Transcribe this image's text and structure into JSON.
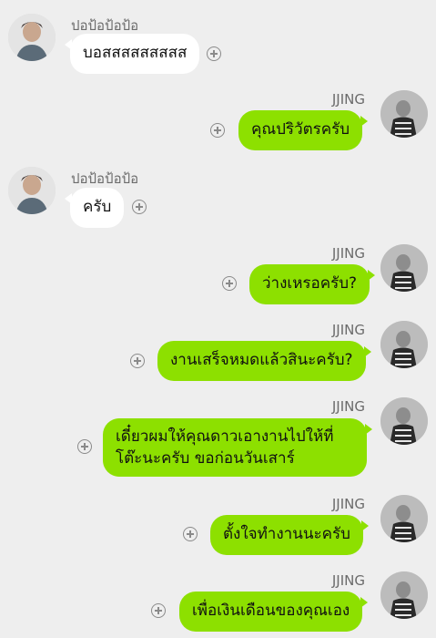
{
  "messages": [
    {
      "sender": "ปอป้อป้อป้อ",
      "side": "in",
      "text": "บอสสสสสสสสส"
    },
    {
      "sender": "JJING",
      "side": "out",
      "text": "คุณปริวัตรครับ"
    },
    {
      "sender": "ปอป้อป้อป้อ",
      "side": "in",
      "text": "ครับ"
    },
    {
      "sender": "JJING",
      "side": "out",
      "text": "ว่างเหรอครับ?"
    },
    {
      "sender": "JJING",
      "side": "out",
      "text": "งานเสร็จหมดแล้วสินะครับ?"
    },
    {
      "sender": "JJING",
      "side": "out",
      "lines": [
        "เดี๋ยวผมให้คุณดาวเอางานไปให้ที่",
        "โต๊ะนะครับ ขอก่อนวันเสาร์"
      ]
    },
    {
      "sender": "JJING",
      "side": "out",
      "text": "ตั้งใจทำงานนะครับ"
    },
    {
      "sender": "JJING",
      "side": "out",
      "text": "เพื่อเงินเดือนของคุณเอง"
    }
  ],
  "icons": {
    "add": "plus-circle-icon",
    "avatar_in": "avatar",
    "avatar_out": "avatar"
  },
  "colors": {
    "background": "#eeeeee",
    "outgoing_bubble": "#8de000",
    "incoming_bubble": "#ffffff"
  }
}
